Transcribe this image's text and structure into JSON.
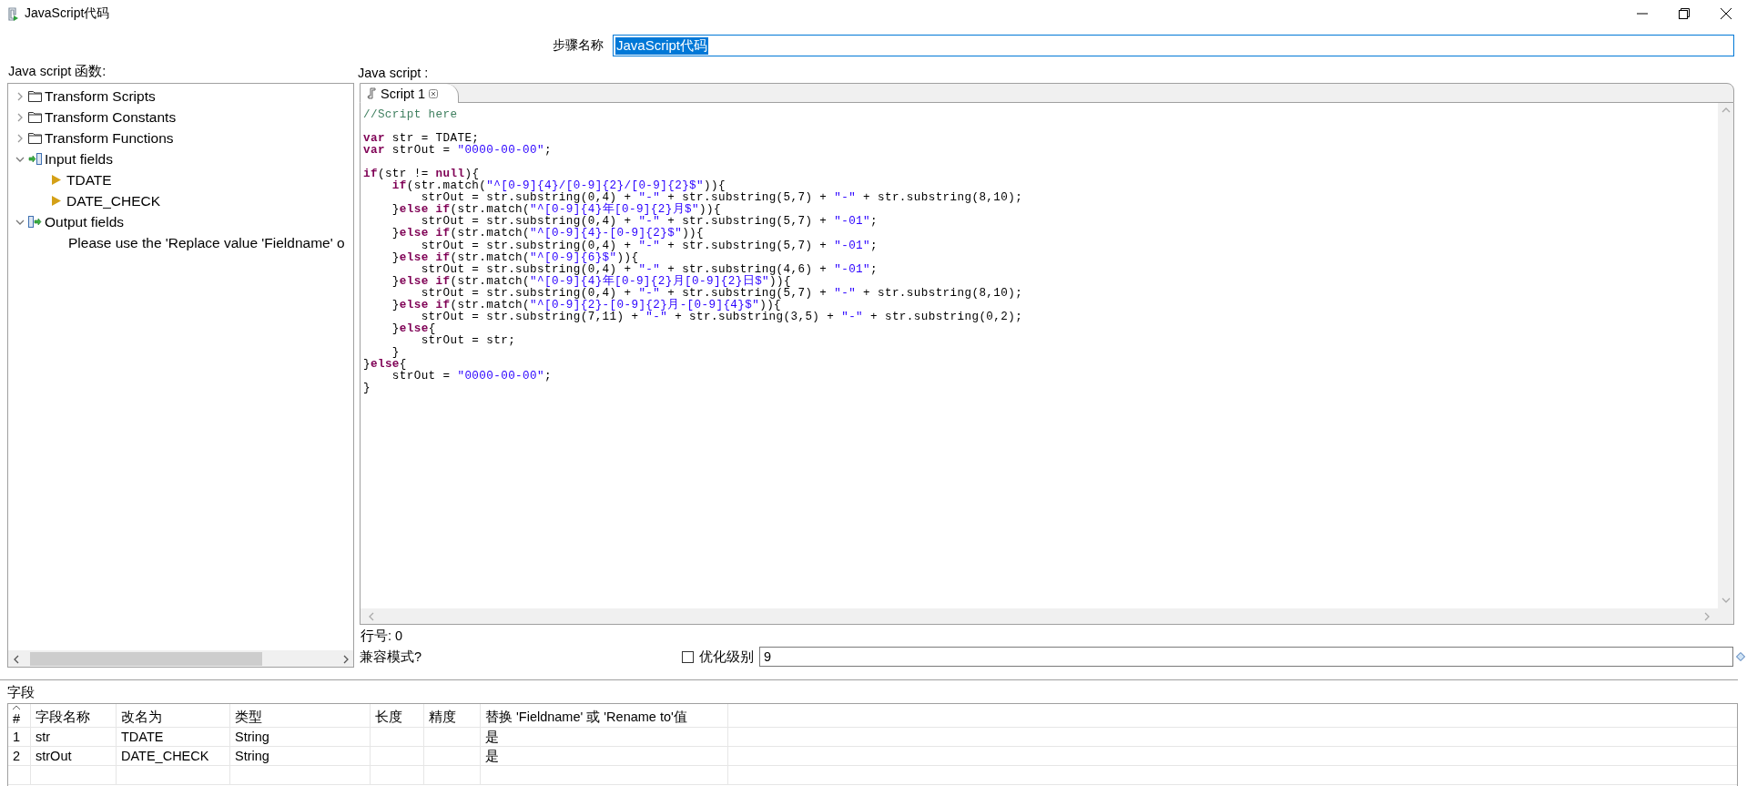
{
  "window": {
    "title": "JavaScript代码"
  },
  "step_name": {
    "label": "步骤名称",
    "value": "JavaScript代码",
    "text_selected": true
  },
  "functions_panel": {
    "label": "Java script 函数:",
    "tree": [
      {
        "label": "Transform Scripts",
        "kind": "folder",
        "expanded": false
      },
      {
        "label": "Transform Constants",
        "kind": "folder",
        "expanded": false
      },
      {
        "label": "Transform Functions",
        "kind": "folder",
        "expanded": false
      },
      {
        "label": "Input fields",
        "kind": "input",
        "expanded": true,
        "children": [
          {
            "label": "TDATE",
            "kind": "field"
          },
          {
            "label": "DATE_CHECK",
            "kind": "field"
          }
        ]
      },
      {
        "label": "Output fields",
        "kind": "output",
        "expanded": true,
        "children": [
          {
            "label": "Please use the 'Replace value 'Fieldname' o",
            "kind": "note"
          }
        ]
      }
    ]
  },
  "script_panel": {
    "label": "Java script :",
    "tabs": [
      {
        "label": "Script 1",
        "selected": true
      }
    ],
    "code": [
      {
        "kind": "code",
        "tokens": [
          {
            "kind": "comment",
            "text": "//Script here"
          }
        ]
      },
      {
        "kind": "blank"
      },
      {
        "kind": "code",
        "tokens": [
          {
            "kind": "keyword",
            "text": "var"
          },
          {
            "kind": "plain",
            "text": " str = TDATE;"
          }
        ]
      },
      {
        "kind": "code",
        "tokens": [
          {
            "kind": "keyword",
            "text": "var"
          },
          {
            "kind": "plain",
            "text": " strOut = "
          },
          {
            "kind": "string",
            "text": "\"0000-00-00\""
          },
          {
            "kind": "plain",
            "text": ";"
          }
        ]
      },
      {
        "kind": "blank"
      },
      {
        "kind": "code",
        "tokens": [
          {
            "kind": "keyword",
            "text": "if"
          },
          {
            "kind": "plain",
            "text": "(str != "
          },
          {
            "kind": "keyword",
            "text": "null"
          },
          {
            "kind": "plain",
            "text": "){"
          }
        ]
      },
      {
        "kind": "code",
        "tokens": [
          {
            "kind": "keyword",
            "text": "    if"
          },
          {
            "kind": "plain",
            "text": "(str.match("
          },
          {
            "kind": "string",
            "text": "\"^[0-9]{4}/[0-9]{2}/[0-9]{2}$\""
          },
          {
            "kind": "plain",
            "text": ")){"
          }
        ]
      },
      {
        "kind": "code",
        "tokens": [
          {
            "kind": "plain",
            "text": "        strOut = str.substring(0,4) + "
          },
          {
            "kind": "string",
            "text": "\"-\""
          },
          {
            "kind": "plain",
            "text": " + str.substring(5,7) + "
          },
          {
            "kind": "string",
            "text": "\"-\""
          },
          {
            "kind": "plain",
            "text": " + str.substring(8,10);"
          }
        ]
      },
      {
        "kind": "code",
        "tokens": [
          {
            "kind": "plain",
            "text": "    }"
          },
          {
            "kind": "keyword",
            "text": "else if"
          },
          {
            "kind": "plain",
            "text": "(str.match("
          },
          {
            "kind": "string",
            "text": "\"^[0-9]{4}年[0-9]{2}月$\""
          },
          {
            "kind": "plain",
            "text": ")){"
          }
        ]
      },
      {
        "kind": "code",
        "tokens": [
          {
            "kind": "plain",
            "text": "        strOut = str.substring(0,4) + "
          },
          {
            "kind": "string",
            "text": "\"-\""
          },
          {
            "kind": "plain",
            "text": " + str.substring(5,7) + "
          },
          {
            "kind": "string",
            "text": "\"-01\""
          },
          {
            "kind": "plain",
            "text": ";"
          }
        ]
      },
      {
        "kind": "code",
        "tokens": [
          {
            "kind": "plain",
            "text": "    }"
          },
          {
            "kind": "keyword",
            "text": "else if"
          },
          {
            "kind": "plain",
            "text": "(str.match("
          },
          {
            "kind": "string",
            "text": "\"^[0-9]{4}-[0-9]{2}$\""
          },
          {
            "kind": "plain",
            "text": ")){"
          }
        ]
      },
      {
        "kind": "code",
        "tokens": [
          {
            "kind": "plain",
            "text": "        strOut = str.substring(0,4) + "
          },
          {
            "kind": "string",
            "text": "\"-\""
          },
          {
            "kind": "plain",
            "text": " + str.substring(5,7) + "
          },
          {
            "kind": "string",
            "text": "\"-01\""
          },
          {
            "kind": "plain",
            "text": ";"
          }
        ]
      },
      {
        "kind": "code",
        "tokens": [
          {
            "kind": "plain",
            "text": "    }"
          },
          {
            "kind": "keyword",
            "text": "else if"
          },
          {
            "kind": "plain",
            "text": "(str.match("
          },
          {
            "kind": "string",
            "text": "\"^[0-9]{6}$\""
          },
          {
            "kind": "plain",
            "text": ")){"
          }
        ]
      },
      {
        "kind": "code",
        "tokens": [
          {
            "kind": "plain",
            "text": "        strOut = str.substring(0,4) + "
          },
          {
            "kind": "string",
            "text": "\"-\""
          },
          {
            "kind": "plain",
            "text": " + str.substring(4,6) + "
          },
          {
            "kind": "string",
            "text": "\"-01\""
          },
          {
            "kind": "plain",
            "text": ";"
          }
        ]
      },
      {
        "kind": "code",
        "tokens": [
          {
            "kind": "plain",
            "text": "    }"
          },
          {
            "kind": "keyword",
            "text": "else if"
          },
          {
            "kind": "plain",
            "text": "(str.match("
          },
          {
            "kind": "string",
            "text": "\"^[0-9]{4}年[0-9]{2}月[0-9]{2}日$\""
          },
          {
            "kind": "plain",
            "text": ")){"
          }
        ]
      },
      {
        "kind": "code",
        "tokens": [
          {
            "kind": "plain",
            "text": "        strOut = str.substring(0,4) + "
          },
          {
            "kind": "string",
            "text": "\"-\""
          },
          {
            "kind": "plain",
            "text": " + str.substring(5,7) + "
          },
          {
            "kind": "string",
            "text": "\"-\""
          },
          {
            "kind": "plain",
            "text": " + str.substring(8,10);"
          }
        ]
      },
      {
        "kind": "code",
        "tokens": [
          {
            "kind": "plain",
            "text": "    }"
          },
          {
            "kind": "keyword",
            "text": "else if"
          },
          {
            "kind": "plain",
            "text": "(str.match("
          },
          {
            "kind": "string",
            "text": "\"^[0-9]{2}-[0-9]{2}月-[0-9]{4}$\""
          },
          {
            "kind": "plain",
            "text": ")){"
          }
        ]
      },
      {
        "kind": "code",
        "tokens": [
          {
            "kind": "plain",
            "text": "        strOut = str.substring(7,11) + "
          },
          {
            "kind": "string",
            "text": "\"-\""
          },
          {
            "kind": "plain",
            "text": " + str.substring(3,5) + "
          },
          {
            "kind": "string",
            "text": "\"-\""
          },
          {
            "kind": "plain",
            "text": " + str.substring(0,2);"
          }
        ]
      },
      {
        "kind": "code",
        "tokens": [
          {
            "kind": "plain",
            "text": "    }"
          },
          {
            "kind": "keyword",
            "text": "else"
          },
          {
            "kind": "plain",
            "text": "{"
          }
        ]
      },
      {
        "kind": "code",
        "tokens": [
          {
            "kind": "plain",
            "text": "        strOut = str;"
          }
        ]
      },
      {
        "kind": "code",
        "tokens": [
          {
            "kind": "plain",
            "text": "    }"
          }
        ]
      },
      {
        "kind": "code",
        "tokens": [
          {
            "kind": "plain",
            "text": "}"
          },
          {
            "kind": "keyword",
            "text": "else"
          },
          {
            "kind": "plain",
            "text": "{"
          }
        ]
      },
      {
        "kind": "code",
        "tokens": [
          {
            "kind": "plain",
            "text": "    strOut = "
          },
          {
            "kind": "string",
            "text": "\"0000-00-00\""
          },
          {
            "kind": "plain",
            "text": ";"
          }
        ]
      },
      {
        "kind": "code",
        "tokens": [
          {
            "kind": "plain",
            "text": "}"
          }
        ]
      }
    ],
    "line_number": "行号: 0",
    "compat_mode": "兼容模式?",
    "optimize": {
      "label": "优化级别",
      "checked": false,
      "value": "9"
    }
  },
  "fields": {
    "label": "字段",
    "columns": [
      "#",
      "字段名称",
      "改名为",
      "类型",
      "长度",
      "精度",
      "替换 'Fieldname' 或 'Rename to'值"
    ],
    "rows": [
      [
        "1",
        "str",
        "TDATE",
        "String",
        "",
        "",
        "是"
      ],
      [
        "2",
        "strOut",
        "DATE_CHECK",
        "String",
        "",
        "",
        "是"
      ]
    ]
  }
}
